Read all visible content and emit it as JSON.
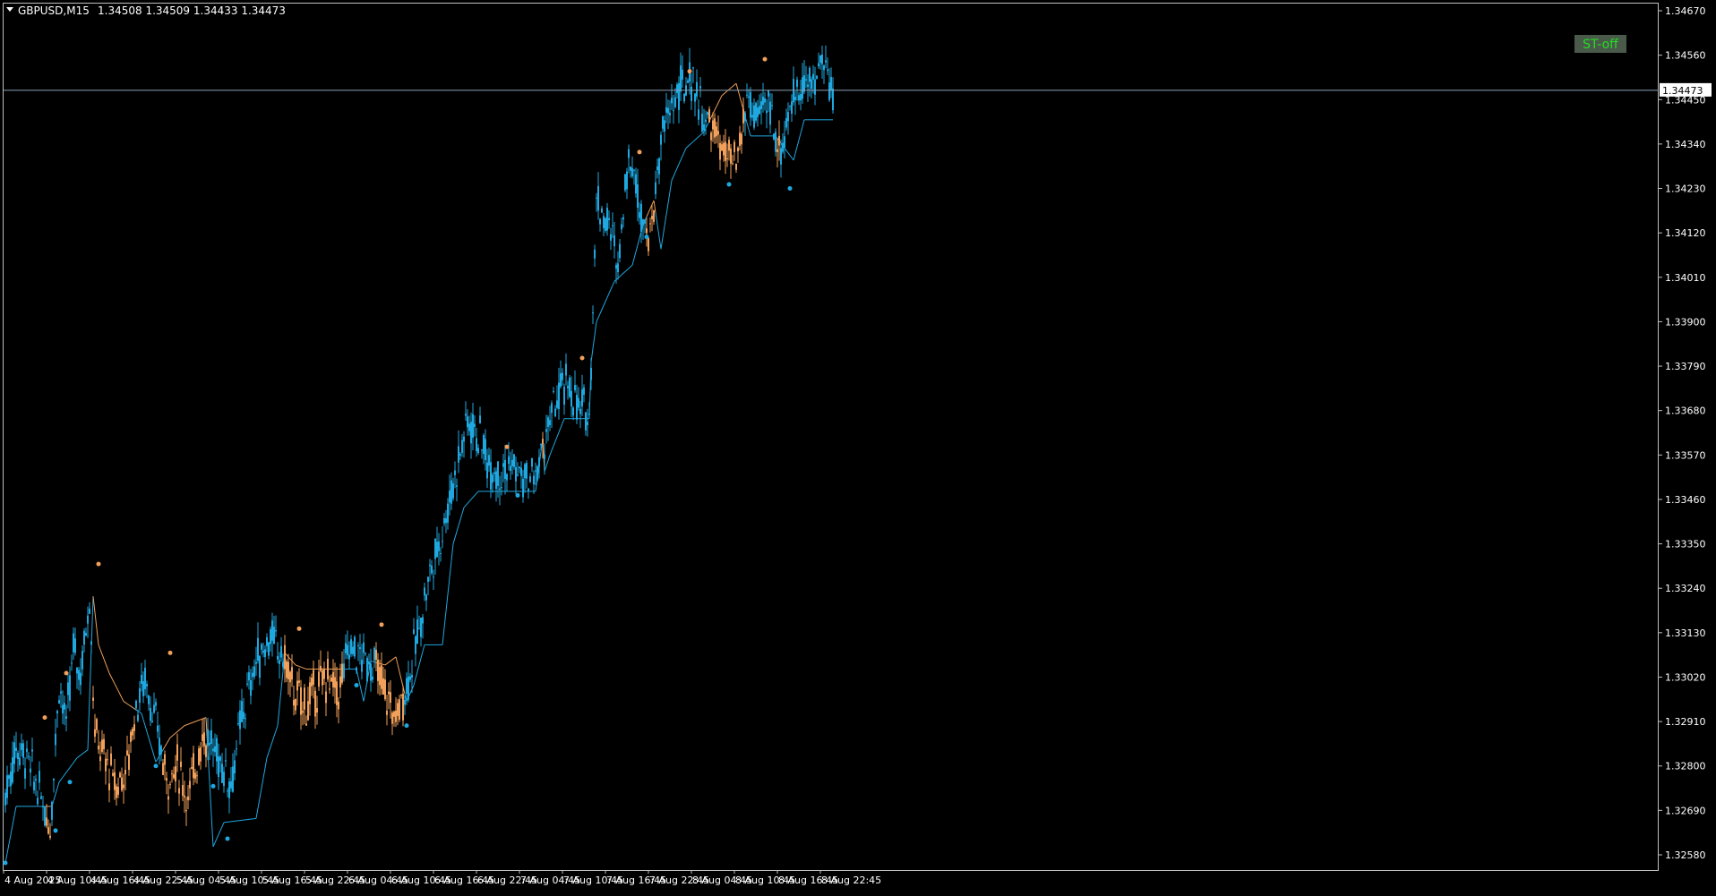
{
  "header": {
    "symbol": "GBPUSD,M15",
    "ohlc": "1.34508 1.34509 1.34433 1.34473"
  },
  "badge": {
    "label": "ST-off",
    "bg": "#4a5a4a",
    "color": "#22dd22"
  },
  "current_price_label": "1.34473",
  "colors": {
    "background": "#000000",
    "frame": "#c0c0c0",
    "text": "#ffffff",
    "bull": "#1fa8e0",
    "bear": "#f0a05a",
    "bid_line": "#8aa0b8"
  },
  "chart_data": {
    "type": "candlestick",
    "title": "GBPUSD,M15",
    "ylim": [
      1.3253,
      1.3472
    ],
    "y_ticks": [
      "1.34670",
      "1.34560",
      "1.34450",
      "1.34340",
      "1.34230",
      "1.34120",
      "1.34010",
      "1.33900",
      "1.33790",
      "1.33680",
      "1.33570",
      "1.33460",
      "1.33350",
      "1.33240",
      "1.33130",
      "1.33020",
      "1.32910",
      "1.32800",
      "1.32690",
      "1.32580"
    ],
    "x_ticks": [
      "4 Aug 2025",
      "4 Aug 10:45",
      "4 Aug 16:45",
      "4 Aug 22:45",
      "5 Aug 04:45",
      "5 Aug 10:45",
      "5 Aug 16:45",
      "5 Aug 22:45",
      "6 Aug 04:45",
      "6 Aug 10:45",
      "6 Aug 16:45",
      "6 Aug 22:45",
      "7 Aug 04:45",
      "7 Aug 10:45",
      "7 Aug 16:45",
      "7 Aug 22:45",
      "8 Aug 04:45",
      "8 Aug 10:45",
      "8 Aug 16:45",
      "8 Aug 22:45"
    ],
    "last_price": 1.34473,
    "bars_per_tick": 24,
    "series": [
      {
        "name": "price_path",
        "anchors": [
          [
            0,
            1.3273
          ],
          [
            6,
            1.3285
          ],
          [
            12,
            1.3282
          ],
          [
            20,
            1.3272
          ],
          [
            25,
            1.3265
          ],
          [
            30,
            1.3301
          ],
          [
            34,
            1.329
          ],
          [
            38,
            1.3309
          ],
          [
            42,
            1.3303
          ],
          [
            47,
            1.3322
          ],
          [
            50,
            1.3288
          ],
          [
            56,
            1.3281
          ],
          [
            62,
            1.3275
          ],
          [
            68,
            1.328
          ],
          [
            72,
            1.3293
          ],
          [
            78,
            1.3302
          ],
          [
            84,
            1.329
          ],
          [
            90,
            1.3277
          ],
          [
            96,
            1.328
          ],
          [
            102,
            1.3272
          ],
          [
            110,
            1.3288
          ],
          [
            118,
            1.3283
          ],
          [
            126,
            1.3276
          ],
          [
            132,
            1.3292
          ],
          [
            140,
            1.3306
          ],
          [
            148,
            1.3312
          ],
          [
            156,
            1.3306
          ],
          [
            162,
            1.3297
          ],
          [
            168,
            1.3295
          ],
          [
            174,
            1.3299
          ],
          [
            180,
            1.3302
          ],
          [
            186,
            1.3298
          ],
          [
            192,
            1.331
          ],
          [
            198,
            1.3307
          ],
          [
            206,
            1.3305
          ],
          [
            212,
            1.3298
          ],
          [
            218,
            1.3292
          ],
          [
            224,
            1.33
          ],
          [
            230,
            1.3312
          ],
          [
            236,
            1.3326
          ],
          [
            242,
            1.3335
          ],
          [
            250,
            1.335
          ],
          [
            258,
            1.3366
          ],
          [
            264,
            1.3362
          ],
          [
            270,
            1.3355
          ],
          [
            276,
            1.3353
          ],
          [
            284,
            1.3354
          ],
          [
            290,
            1.335
          ],
          [
            296,
            1.3352
          ],
          [
            302,
            1.3362
          ],
          [
            308,
            1.3371
          ],
          [
            314,
            1.3375
          ],
          [
            320,
            1.3368
          ],
          [
            326,
            1.3368
          ],
          [
            330,
            1.342
          ],
          [
            336,
            1.3415
          ],
          [
            342,
            1.3405
          ],
          [
            348,
            1.3432
          ],
          [
            354,
            1.342
          ],
          [
            360,
            1.341
          ],
          [
            366,
            1.3435
          ],
          [
            372,
            1.3444
          ],
          [
            378,
            1.3448
          ],
          [
            384,
            1.345
          ],
          [
            390,
            1.344
          ],
          [
            396,
            1.3437
          ],
          [
            402,
            1.3431
          ],
          [
            408,
            1.3428
          ],
          [
            414,
            1.3445
          ],
          [
            420,
            1.344
          ],
          [
            426,
            1.3445
          ],
          [
            432,
            1.3432
          ],
          [
            438,
            1.3442
          ],
          [
            444,
            1.345
          ],
          [
            450,
            1.3448
          ],
          [
            456,
            1.3455
          ],
          [
            462,
            1.3447
          ]
        ]
      },
      {
        "name": "trend_line",
        "anchors": [
          [
            0,
            1.3256
          ],
          [
            6,
            1.327
          ],
          [
            26,
            1.327
          ],
          [
            30,
            1.3276
          ],
          [
            40,
            1.3282
          ],
          [
            46,
            1.3284
          ],
          [
            49,
            1.3322
          ],
          [
            52,
            1.331
          ],
          [
            58,
            1.3303
          ],
          [
            66,
            1.3296
          ],
          [
            76,
            1.3293
          ],
          [
            84,
            1.3281
          ],
          [
            92,
            1.3287
          ],
          [
            100,
            1.329
          ],
          [
            112,
            1.3292
          ],
          [
            116,
            1.326
          ],
          [
            122,
            1.3266
          ],
          [
            140,
            1.3267
          ],
          [
            146,
            1.3282
          ],
          [
            152,
            1.329
          ],
          [
            156,
            1.3308
          ],
          [
            162,
            1.3305
          ],
          [
            168,
            1.3304
          ],
          [
            180,
            1.3304
          ],
          [
            196,
            1.3304
          ],
          [
            200,
            1.3296
          ],
          [
            204,
            1.3306
          ],
          [
            212,
            1.3305
          ],
          [
            218,
            1.3307
          ],
          [
            224,
            1.3296
          ],
          [
            228,
            1.33
          ],
          [
            234,
            1.331
          ],
          [
            244,
            1.331
          ],
          [
            250,
            1.3335
          ],
          [
            256,
            1.3344
          ],
          [
            264,
            1.3348
          ],
          [
            290,
            1.3348
          ],
          [
            296,
            1.3348
          ],
          [
            300,
            1.3361
          ],
          [
            292,
            1.3359
          ],
          [
            296,
            1.3346
          ],
          [
            304,
            1.3357
          ],
          [
            312,
            1.3366
          ],
          [
            326,
            1.3366
          ],
          [
            327,
            1.338
          ],
          [
            330,
            1.339
          ],
          [
            340,
            1.34
          ],
          [
            350,
            1.3404
          ],
          [
            356,
            1.3414
          ],
          [
            362,
            1.342
          ],
          [
            366,
            1.3408
          ],
          [
            372,
            1.3425
          ],
          [
            380,
            1.3433
          ],
          [
            390,
            1.3437
          ],
          [
            400,
            1.3446
          ],
          [
            408,
            1.3449
          ],
          [
            416,
            1.3436
          ],
          [
            424,
            1.3436
          ],
          [
            430,
            1.3436
          ],
          [
            440,
            1.343
          ],
          [
            446,
            1.344
          ],
          [
            462,
            1.344
          ]
        ],
        "flips": [
          [
            0,
            1.3256,
            "bull"
          ],
          [
            28,
            1.3264,
            "bull"
          ],
          [
            36,
            1.3276,
            "bull"
          ],
          [
            22,
            1.3292,
            "bear"
          ],
          [
            34,
            1.3303,
            "bear"
          ],
          [
            52,
            1.333,
            "bear"
          ],
          [
            84,
            1.328,
            "bull"
          ],
          [
            92,
            1.3308,
            "bear"
          ],
          [
            116,
            1.3275,
            "bull"
          ],
          [
            124,
            1.3262,
            "bull"
          ],
          [
            164,
            1.3314,
            "bear"
          ],
          [
            196,
            1.33,
            "bull"
          ],
          [
            210,
            1.3315,
            "bear"
          ],
          [
            224,
            1.329,
            "bull"
          ],
          [
            280,
            1.3359,
            "bear"
          ],
          [
            286,
            1.3347,
            "bull"
          ],
          [
            322,
            1.3381,
            "bear"
          ],
          [
            354,
            1.3432,
            "bear"
          ],
          [
            358,
            1.3411,
            "bull"
          ],
          [
            382,
            1.3452,
            "bear"
          ],
          [
            404,
            1.3424,
            "bull"
          ],
          [
            424,
            1.3455,
            "bear"
          ],
          [
            438,
            1.3423,
            "bull"
          ]
        ]
      }
    ]
  }
}
